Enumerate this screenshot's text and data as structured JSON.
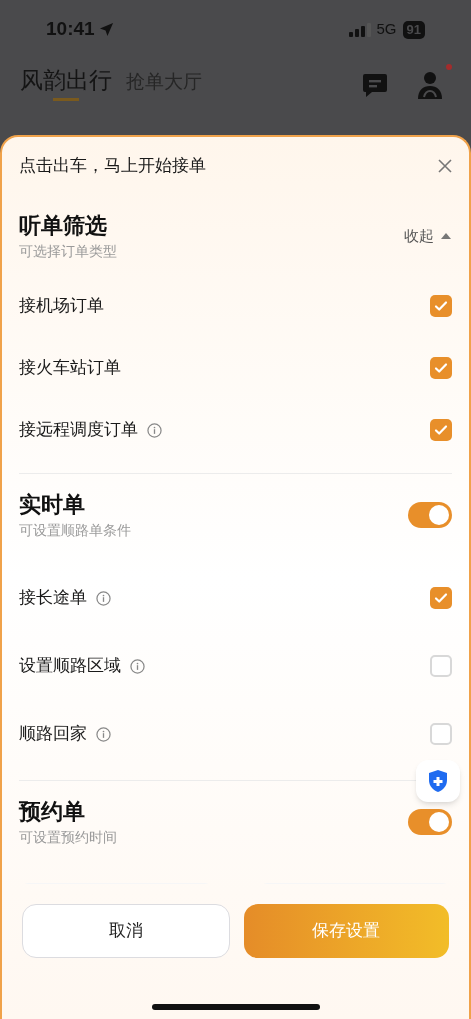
{
  "status_bar": {
    "time": "10:41",
    "network": "5G",
    "battery": "91"
  },
  "header": {
    "tabs": [
      {
        "label": "风韵出行",
        "selected": true
      },
      {
        "label": "抢单大厅",
        "selected": false
      }
    ],
    "notification_dot": true
  },
  "sheet": {
    "title": "点击出车，马上开始接单",
    "sections": [
      {
        "kind": "collapse",
        "title": "听单筛选",
        "subtitle": "可选择订单类型",
        "collapse_label": "收起",
        "expanded": true,
        "items": [
          {
            "label": "接机场订单",
            "info": false,
            "checked": true
          },
          {
            "label": "接火车站订单",
            "info": false,
            "checked": true
          },
          {
            "label": "接远程调度订单",
            "info": true,
            "checked": true
          }
        ]
      },
      {
        "kind": "toggle",
        "title": "实时单",
        "subtitle": "可设置顺路单条件",
        "on": true,
        "items": [
          {
            "label": "接长途单",
            "info": true,
            "checked": true
          },
          {
            "label": "设置顺路区域",
            "info": true,
            "checked": false
          },
          {
            "label": "顺路回家",
            "info": true,
            "checked": false
          }
        ]
      },
      {
        "kind": "toggle",
        "title": "预约单",
        "subtitle": "可设置预约时间",
        "on": true
      }
    ]
  },
  "buttons": {
    "cancel": "取消",
    "save": "保存设置"
  }
}
